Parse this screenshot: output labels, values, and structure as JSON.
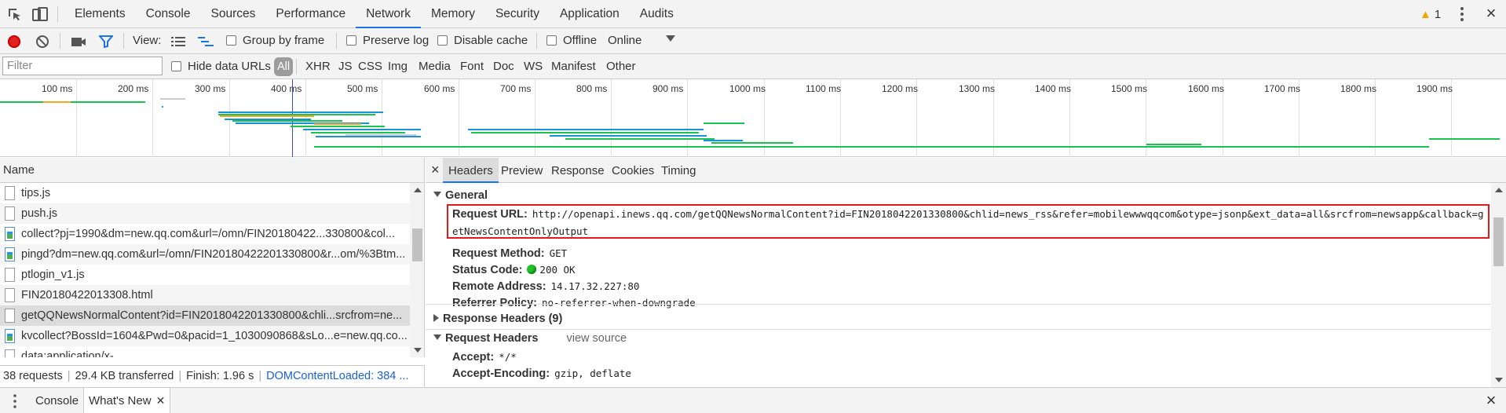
{
  "top_bar": {
    "panel_tabs": [
      "Elements",
      "Console",
      "Sources",
      "Performance",
      "Network",
      "Memory",
      "Security",
      "Application",
      "Audits"
    ],
    "active_tab": "Network",
    "warning_count": "1",
    "icons": [
      "inspect-element-icon",
      "device-toolbar-icon",
      "kebab-menu-icon",
      "close-icon"
    ]
  },
  "toolbar": {
    "view_label": "View:",
    "group_by_frame": "Group by frame",
    "preserve_log": "Preserve log",
    "disable_cache": "Disable cache",
    "offline": "Offline",
    "throttling": "Online",
    "icons": [
      "record-icon",
      "clear-icon",
      "screenshot-icon",
      "filter-icon",
      "large-rows-icon",
      "waterfall-icon",
      "dropdown-icon"
    ]
  },
  "filter_bar": {
    "placeholder": "Filter",
    "hide_data_urls": "Hide data URLs",
    "types": [
      "All",
      "XHR",
      "JS",
      "CSS",
      "Img",
      "Media",
      "Font",
      "Doc",
      "WS",
      "Manifest",
      "Other"
    ],
    "active_type": "All"
  },
  "overview": {
    "tick_labels": [
      "100 ms",
      "200 ms",
      "300 ms",
      "400 ms",
      "500 ms",
      "600 ms",
      "700 ms",
      "800 ms",
      "900 ms",
      "1000 ms",
      "1100 ms",
      "1200 ms",
      "1300 ms",
      "1400 ms",
      "1500 ms",
      "1600 ms",
      "1700 ms",
      "1800 ms",
      "1900 ms",
      "200"
    ]
  },
  "request_list": {
    "column_header": "Name",
    "rows": [
      {
        "name": "tips.js",
        "icon": "file-icon"
      },
      {
        "name": "push.js",
        "icon": "file-icon"
      },
      {
        "name": "collect?pj=1990&dm=new.qq.com&url=/omn/FIN20180422...330800&col...",
        "icon": "image-icon"
      },
      {
        "name": "pingd?dm=new.qq.com&url=/omn/FIN20180422201330800&r...om/%3Btm...",
        "icon": "image-icon"
      },
      {
        "name": "ptlogin_v1.js",
        "icon": "file-icon"
      },
      {
        "name": "FIN20180422013308.html",
        "icon": "file-icon"
      },
      {
        "name": "getQQNewsNormalContent?id=FIN2018042201330800&chli...srcfrom=ne...",
        "icon": "file-icon",
        "selected": true
      },
      {
        "name": "kvcollect?BossId=1604&Pwd=0&pacid=1_1030090868&sLo...e=new.qq.co...",
        "icon": "image-icon"
      },
      {
        "name": "data:application/x-...",
        "icon": "file-icon"
      }
    ]
  },
  "summary": {
    "requests": "38 requests",
    "transferred": "29.4 KB transferred",
    "finish": "Finish: 1.96 s",
    "dom_content_loaded": "DOMContentLoaded: 384 ..."
  },
  "detail_tabs": [
    "Headers",
    "Preview",
    "Response",
    "Cookies",
    "Timing"
  ],
  "active_detail_tab": "Headers",
  "headers": {
    "general_title": "General",
    "request_url_key": "Request URL:",
    "request_url": "http://openapi.inews.qq.com/getQQNewsNormalContent?id=FIN2018042201330800&chlid=news_rss&refer=mobilewwwqqcom&otype=jsonp&ext_data=all&srcfrom=newsapp&callback=getNewsContentOnlyOutput",
    "request_method_key": "Request Method:",
    "request_method": "GET",
    "status_code_key": "Status Code:",
    "status_code": "200 OK",
    "remote_address_key": "Remote Address:",
    "remote_address": "14.17.32.227:80",
    "referrer_policy_key": "Referrer Policy:",
    "referrer_policy": "no-referrer-when-downgrade",
    "response_headers_title": "Response Headers (9)",
    "request_headers_title": "Request Headers",
    "view_source": "view source",
    "accept_key": "Accept:",
    "accept": "*/*",
    "accept_encoding_key": "Accept-Encoding:",
    "accept_encoding": "gzip, deflate"
  },
  "drawer": {
    "tabs": [
      "Console",
      "What's New"
    ],
    "active_tab": "What's New"
  },
  "colors": {
    "accent_blue": "#1a73e8",
    "record_red": "#e32020",
    "highlight_box": "#e01b1b",
    "status_green": "#24c22a",
    "dcl_blue": "#1a5fdc"
  }
}
